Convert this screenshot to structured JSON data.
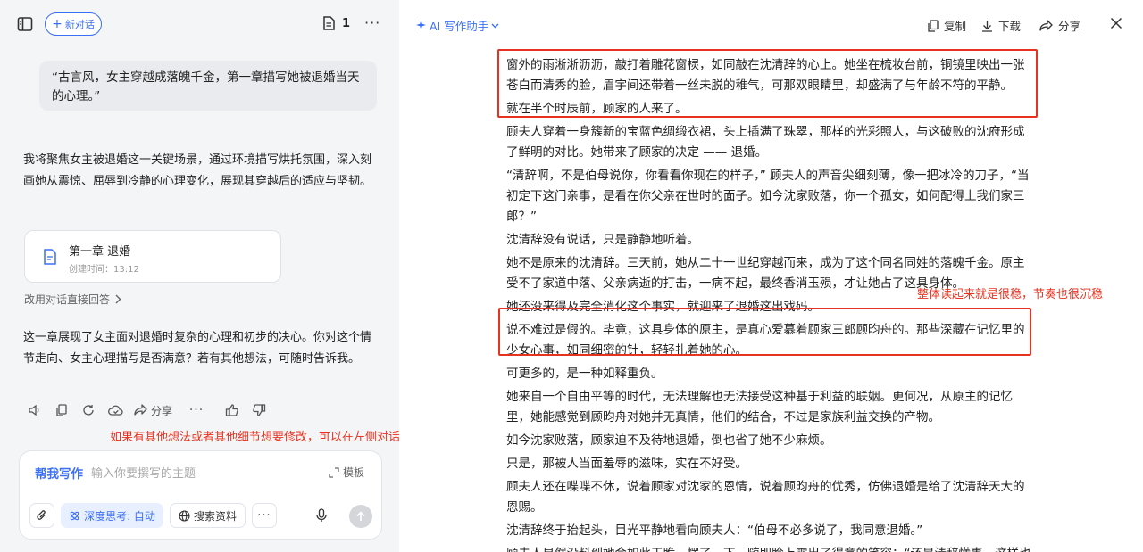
{
  "left": {
    "new_chat_label": "新对话",
    "doc_count": "1",
    "user_prompt": "“古言风，女主穿越成落魄千金，第一章描写她被退婚当天的心理。”",
    "ai_intro": "我将聚焦女主被退婚这一关键场景，通过环境描写烘托氛围，深入刻画她从震惊、屈辱到冷静的心理变化，展现其穿越后的适应与坚韧。",
    "doc_card": {
      "title": "第一章 退婚",
      "time": "创建时间：13:12"
    },
    "change_link": "改用对话直接回答",
    "ai_summary": "这一章展现了女主面对退婚时复杂的心理和初步的决心。你对这个情节走向、女主心理描写是否满意？若有其他想法，可随时告诉我。",
    "share_label": "分享",
    "annotation": "如果有其他想法或者其他细节想要修改，可以在左侧对话框内输入要求",
    "composer": {
      "label": "帮我写作",
      "placeholder": "输入你要撰写的主题",
      "template_label": "模板",
      "deep_think_label": "深度思考: 自动",
      "search_label": "搜索资料"
    }
  },
  "right": {
    "assistant_label": "AI 写作助手",
    "copy_label": "复制",
    "download_label": "下载",
    "share_label": "分享",
    "annotation": "整体读起来就是很稳，节奏也很沉稳",
    "paragraphs": [
      "窗外的雨淅淅沥沥，敲打着雕花窗棂，如同敲在沈清辞的心上。她坐在梳妆台前，铜镜里映出一张苍白而清秀的脸，眉宇间还带着一丝未脱的稚气，可那双眼睛里，却盛满了与年龄不符的平静。",
      "就在半个时辰前，顾家的人来了。",
      "顾夫人穿着一身簇新的宝蓝色绸缎衣裙，头上插满了珠翠，那样的光彩照人，与这破败的沈府形成了鲜明的对比。她带来了顾家的决定 —— 退婚。",
      "“清辞啊，不是伯母说你，你看看你现在的样子，” 顾夫人的声音尖细刻薄，像一把冰冷的刀子，“当初定下这门亲事，是看在你父亲在世时的面子。如今沈家败落，你一个孤女，如何配得上我们家三郎？”",
      "沈清辞没有说话，只是静静地听着。",
      "她不是原来的沈清辞。三天前，她从二十一世纪穿越而来，成为了这个同名同姓的落魄千金。原主受不了家道中落、父亲病逝的打击，一病不起，最终香消玉殒，才让她占了这具身体。",
      "她还没来得及完全消化这个事实，就迎来了退婚这出戏码。",
      "说不难过是假的。毕竟，这具身体的原主，是真心爱慕着顾家三郎顾昀舟的。那些深藏在记忆里的少女心事，如同细密的针，轻轻扎着她的心。",
      "可更多的，是一种如释重负。",
      "她来自一个自由平等的时代，无法理解也无法接受这种基于利益的联姻。更何况，从原主的记忆里，她能感觉到顾昀舟对她并无真情，他们的结合，不过是家族利益交换的产物。",
      "如今沈家败落，顾家迫不及待地退婚，倒也省了她不少麻烦。",
      "只是，那被人当面羞辱的滋味，实在不好受。",
      "顾夫人还在喋喋不休，说着顾家对沈家的恩情，说着顾昀舟的优秀，仿佛退婚是给了沈清辞天大的恩赐。",
      "沈清辞终于抬起头，目光平静地看向顾夫人：“伯母不必多说了，我同意退婚。”",
      "顾夫人显然没料到她会如此干脆，愣了一下，随即脸上露出了得意的笑容：“还是清辞懂事。这样也"
    ]
  },
  "colors": {
    "accent": "#3b6ff5",
    "annotation_red": "#e8321f"
  }
}
